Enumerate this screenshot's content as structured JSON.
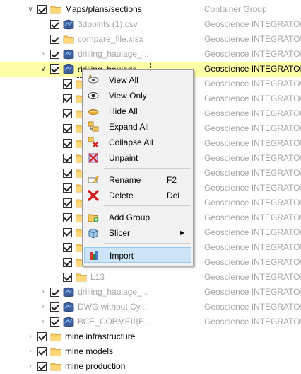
{
  "tree": {
    "rows": [
      {
        "name": "Maps/plans/sections",
        "type": "Container Group",
        "icon": "folder-icon",
        "expander": "open",
        "indent": 0,
        "dim": false
      },
      {
        "name": "3dpoints (1).csv",
        "type": "Geoscience INTEGRATOR ...",
        "icon": "dataset-icon",
        "expander": "none",
        "indent": 1,
        "dim": true
      },
      {
        "name": "compare_file.xlsx",
        "type": "Geoscience INTEGRATOR ...",
        "icon": "folder-icon",
        "expander": "none",
        "indent": 1,
        "dim": true
      },
      {
        "name": "drilling_haulage_...",
        "type": "Geoscience INTEGRATOR ...",
        "icon": "dataset-icon",
        "expander": "closed",
        "indent": 1,
        "dim": true
      },
      {
        "name": "drilling_haulage_...",
        "type": "Geoscience INTEGRATOR ...",
        "icon": "dataset-icon",
        "expander": "open",
        "indent": 1,
        "dim": false,
        "highlight": true
      },
      {
        "name": "",
        "type": "Geoscience INTEGRATOR ...",
        "icon": "folder-icon",
        "expander": "none",
        "indent": 2,
        "dim": true
      },
      {
        "name": "",
        "type": "Geoscience INTEGRATOR ...",
        "icon": "folder-icon",
        "expander": "none",
        "indent": 2,
        "dim": true
      },
      {
        "name": "",
        "type": "Geoscience INTEGRATOR ...",
        "icon": "folder-icon",
        "expander": "none",
        "indent": 2,
        "dim": true
      },
      {
        "name": "",
        "type": "Geoscience INTEGRATOR ...",
        "icon": "folder-icon",
        "expander": "none",
        "indent": 2,
        "dim": true
      },
      {
        "name": "",
        "type": "Geoscience INTEGRATOR ...",
        "icon": "folder-icon",
        "expander": "none",
        "indent": 2,
        "dim": true
      },
      {
        "name": "",
        "type": "Geoscience INTEGRATOR ...",
        "icon": "folder-icon",
        "expander": "none",
        "indent": 2,
        "dim": true
      },
      {
        "name": "",
        "type": "Geoscience INTEGRATOR ...",
        "icon": "folder-icon",
        "expander": "none",
        "indent": 2,
        "dim": true
      },
      {
        "name": "",
        "type": "Geoscience INTEGRATOR ...",
        "icon": "folder-icon",
        "expander": "none",
        "indent": 2,
        "dim": true
      },
      {
        "name": "",
        "type": "Geoscience INTEGRATOR ...",
        "icon": "folder-icon",
        "expander": "none",
        "indent": 2,
        "dim": true
      },
      {
        "name": "",
        "type": "Geoscience INTEGRATOR ...",
        "icon": "folder-icon",
        "expander": "none",
        "indent": 2,
        "dim": true
      },
      {
        "name": "",
        "type": "Geoscience INTEGRATOR ...",
        "icon": "folder-icon",
        "expander": "none",
        "indent": 2,
        "dim": true
      },
      {
        "name": "",
        "type": "Geoscience INTEGRATOR ...",
        "icon": "folder-icon",
        "expander": "none",
        "indent": 2,
        "dim": true
      },
      {
        "name": "",
        "type": "Geoscience INTEGRATOR ...",
        "icon": "folder-icon",
        "expander": "none",
        "indent": 2,
        "dim": true
      },
      {
        "name": "L13",
        "type": "Geoscience INTEGRATOR ...",
        "icon": "folder-icon",
        "expander": "none",
        "indent": 2,
        "dim": true
      },
      {
        "name": "drilling_haulage_...",
        "type": "Geoscience INTEGRATOR ...",
        "icon": "dataset-icon",
        "expander": "closed",
        "indent": 1,
        "dim": true
      },
      {
        "name": "DWG without Cy...",
        "type": "Geoscience INTEGRATOR ...",
        "icon": "dataset-icon",
        "expander": "closed",
        "indent": 1,
        "dim": true
      },
      {
        "name": "ВСЕ_СОВМЕЩЕ...",
        "type": "Geoscience INTEGRATOR ...",
        "icon": "dataset-icon",
        "expander": "closed",
        "indent": 1,
        "dim": true
      },
      {
        "name": "mine infrastructure",
        "type": "",
        "icon": "folder-icon",
        "expander": "closed",
        "indent": 0,
        "dim": false
      },
      {
        "name": "mine models",
        "type": "",
        "icon": "folder-icon",
        "expander": "closed",
        "indent": 0,
        "dim": false
      },
      {
        "name": "mine production",
        "type": "",
        "icon": "folder-icon",
        "expander": "closed",
        "indent": 0,
        "dim": false
      }
    ]
  },
  "context_menu": {
    "items": [
      {
        "label": "View All",
        "shortcut": "",
        "icon": "eye-pencil-icon",
        "name": "view-all"
      },
      {
        "label": "View Only",
        "shortcut": "",
        "icon": "eye-icon",
        "name": "view-only"
      },
      {
        "label": "Hide All",
        "shortcut": "",
        "icon": "hide-eye-icon",
        "name": "hide-all"
      },
      {
        "label": "Expand All",
        "shortcut": "",
        "icon": "expand-icon",
        "name": "expand-all"
      },
      {
        "label": "Collapse All",
        "shortcut": "",
        "icon": "collapse-icon",
        "name": "collapse-all"
      },
      {
        "label": "Unpaint",
        "shortcut": "",
        "icon": "unpaint-icon",
        "name": "unpaint"
      },
      {
        "label": "Rename",
        "shortcut": "F2",
        "icon": "rename-icon",
        "name": "rename"
      },
      {
        "label": "Delete",
        "shortcut": "Del",
        "icon": "delete-icon",
        "name": "delete"
      },
      {
        "label": "Add Group",
        "shortcut": "",
        "icon": "add-group-icon",
        "name": "add-group"
      },
      {
        "label": "Slicer",
        "shortcut": "",
        "icon": "slicer-icon",
        "name": "slicer",
        "submenu": true
      },
      {
        "label": "Import",
        "shortcut": "",
        "icon": "import-icon",
        "name": "import",
        "selected": true
      }
    ]
  },
  "colors": {
    "highlight_row": "#ffffa8",
    "menu_selected": "#cce4f7",
    "dim_text": "#a6a6a6",
    "folder": "#f6c85f",
    "dataset": "#3d5f9c"
  }
}
